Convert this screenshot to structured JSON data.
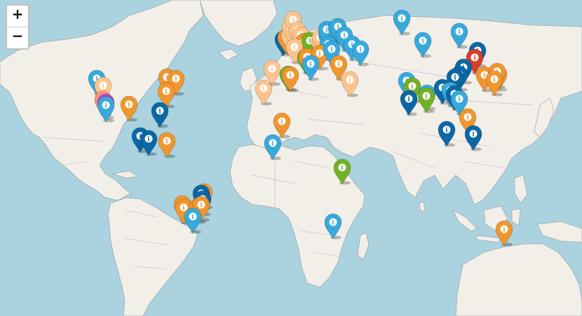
{
  "zoom_in_label": "+",
  "zoom_out_label": "−",
  "marker_icon": "info-icon",
  "marker_glyph": "i",
  "colors": {
    "water": "#aad3df",
    "land": "#f2efe9",
    "green_land": "#cde6c1",
    "border": "#a1a1a8",
    "orange": "#f0962f",
    "light_orange": "#fcc48c",
    "light_blue": "#38a9dc",
    "dark_blue": "#0b67a5",
    "green": "#72b026",
    "red": "#d63e2a",
    "pink": "#ff8e7f",
    "violet": "#a94fc0"
  },
  "markers": [
    {
      "lat": 37.8,
      "lon": -122.4,
      "color": "light_blue"
    },
    {
      "lat": 34.0,
      "lon": -118.2,
      "color": "light_orange"
    },
    {
      "lat": 25.5,
      "lon": -118.5,
      "color": "pink"
    },
    {
      "lat": 24.0,
      "lon": -116.5,
      "color": "violet"
    },
    {
      "lat": 22.5,
      "lon": -116.5,
      "color": "light_blue"
    },
    {
      "lat": 23.0,
      "lon": -101.5,
      "color": "orange"
    },
    {
      "lat": 38.5,
      "lon": -77.0,
      "color": "orange"
    },
    {
      "lat": 38.0,
      "lon": -71.0,
      "color": "orange"
    },
    {
      "lat": 30.5,
      "lon": -77.5,
      "color": "orange"
    },
    {
      "lat": 19.0,
      "lon": -81.5,
      "color": "dark_blue"
    },
    {
      "lat": 4.5,
      "lon": -94.0,
      "color": "dark_blue"
    },
    {
      "lat": 3.0,
      "lon": -88.5,
      "color": "dark_blue"
    },
    {
      "lat": 1.5,
      "lon": -77.0,
      "color": "orange"
    },
    {
      "lat": -35.0,
      "lon": -67.0,
      "color": "orange"
    },
    {
      "lat": -37.0,
      "lon": -66.0,
      "color": "orange"
    },
    {
      "lat": -28.0,
      "lon": -52.5,
      "color": "orange"
    },
    {
      "lat": -29.0,
      "lon": -54.5,
      "color": "dark_blue"
    },
    {
      "lat": -32.0,
      "lon": -53.5,
      "color": "dark_blue"
    },
    {
      "lat": -36.5,
      "lon": -56.5,
      "color": "orange"
    },
    {
      "lat": -35.5,
      "lon": -54.5,
      "color": "orange"
    },
    {
      "lat": -42.5,
      "lon": -60.0,
      "color": "light_blue"
    },
    {
      "lat": 13.0,
      "lon": -2.0,
      "color": "orange"
    },
    {
      "lat": 0.5,
      "lon": -8.0,
      "color": "light_blue"
    },
    {
      "lat": 32.0,
      "lon": -14.0,
      "color": "light_orange"
    },
    {
      "lat": 43.5,
      "lon": -8.5,
      "color": "light_orange"
    },
    {
      "lat": 60.5,
      "lon": -1.0,
      "color": "dark_blue"
    },
    {
      "lat": 62.0,
      "lon": 1.0,
      "color": "orange"
    },
    {
      "lat": 63.0,
      "lon": 3.0,
      "color": "light_orange"
    },
    {
      "lat": 68.0,
      "lon": 3.5,
      "color": "light_orange"
    },
    {
      "lat": 72.0,
      "lon": 5.5,
      "color": "light_orange"
    },
    {
      "lat": 66.0,
      "lon": 8.0,
      "color": "light_orange"
    },
    {
      "lat": 63.0,
      "lon": 10.5,
      "color": "light_orange"
    },
    {
      "lat": 59.5,
      "lon": 12.5,
      "color": "orange"
    },
    {
      "lat": 60.0,
      "lon": 16.5,
      "color": "green"
    },
    {
      "lat": 56.0,
      "lon": 6.5,
      "color": "light_orange"
    },
    {
      "lat": 59.5,
      "lon": 22.5,
      "color": "light_orange"
    },
    {
      "lat": 62.0,
      "lon": 23.0,
      "color": "light_orange"
    },
    {
      "lat": 63.5,
      "lon": 27.5,
      "color": "light_blue"
    },
    {
      "lat": 66.5,
      "lon": 27.5,
      "color": "light_blue"
    },
    {
      "lat": 67.0,
      "lon": 33.5,
      "color": "light_blue"
    },
    {
      "lat": 68.0,
      "lon": 34.5,
      "color": "light_blue"
    },
    {
      "lat": 58.0,
      "lon": 28.0,
      "color": "light_blue"
    },
    {
      "lat": 63.0,
      "lon": 38.5,
      "color": "light_blue"
    },
    {
      "lat": 58.0,
      "lon": 43.5,
      "color": "light_blue"
    },
    {
      "lat": 55.0,
      "lon": 49.0,
      "color": "light_blue"
    },
    {
      "lat": 50.0,
      "lon": 13.5,
      "color": "green"
    },
    {
      "lat": 50.5,
      "lon": 14.5,
      "color": "orange"
    },
    {
      "lat": 52.5,
      "lon": 22.5,
      "color": "orange"
    },
    {
      "lat": 55.0,
      "lon": 30.5,
      "color": "light_blue"
    },
    {
      "lat": 46.5,
      "lon": 17.0,
      "color": "light_blue"
    },
    {
      "lat": 46.5,
      "lon": 35.0,
      "color": "orange"
    },
    {
      "lat": 40.5,
      "lon": 2.0,
      "color": "green"
    },
    {
      "lat": 40.0,
      "lon": 3.5,
      "color": "orange"
    },
    {
      "lat": 37.0,
      "lon": 42.5,
      "color": "light_orange"
    },
    {
      "lat": 73.0,
      "lon": 76.0,
      "color": "light_blue"
    },
    {
      "lat": 65.0,
      "lon": 113.5,
      "color": "light_blue"
    },
    {
      "lat": 60.0,
      "lon": 90.0,
      "color": "light_blue"
    },
    {
      "lat": 36.5,
      "lon": 79.5,
      "color": "light_blue"
    },
    {
      "lat": 33.5,
      "lon": 83.0,
      "color": "green"
    },
    {
      "lat": 26.0,
      "lon": 80.5,
      "color": "dark_blue"
    },
    {
      "lat": 29.5,
      "lon": 92.5,
      "color": "light_blue"
    },
    {
      "lat": 27.5,
      "lon": 92.0,
      "color": "green"
    },
    {
      "lat": 54.0,
      "lon": 125.5,
      "color": "dark_blue"
    },
    {
      "lat": 50.0,
      "lon": 123.5,
      "color": "red"
    },
    {
      "lat": 44.5,
      "lon": 116.5,
      "color": "dark_blue"
    },
    {
      "lat": 40.5,
      "lon": 113.5,
      "color": "dark_blue"
    },
    {
      "lat": 38.5,
      "lon": 111.0,
      "color": "dark_blue"
    },
    {
      "lat": 32.5,
      "lon": 102.5,
      "color": "dark_blue"
    },
    {
      "lat": 31.0,
      "lon": 107.5,
      "color": "light_blue"
    },
    {
      "lat": 29.0,
      "lon": 110.5,
      "color": "dark_blue"
    },
    {
      "lat": 26.0,
      "lon": 113.5,
      "color": "light_blue"
    },
    {
      "lat": 15.5,
      "lon": 119.0,
      "color": "orange"
    },
    {
      "lat": 8.0,
      "lon": 105.5,
      "color": "dark_blue"
    },
    {
      "lat": 5.5,
      "lon": 122.5,
      "color": "dark_blue"
    },
    {
      "lat": 40.0,
      "lon": 130.0,
      "color": "orange"
    },
    {
      "lat": 40.5,
      "lon": 139.0,
      "color": "orange"
    },
    {
      "lat": 42.0,
      "lon": 138.0,
      "color": "orange"
    },
    {
      "lat": 37.5,
      "lon": 136.5,
      "color": "orange"
    },
    {
      "lat": -14.0,
      "lon": 37.5,
      "color": "green"
    },
    {
      "lat": -45.5,
      "lon": 31.5,
      "color": "light_blue"
    },
    {
      "lat": -49.5,
      "lon": 143.0,
      "color": "orange"
    }
  ]
}
